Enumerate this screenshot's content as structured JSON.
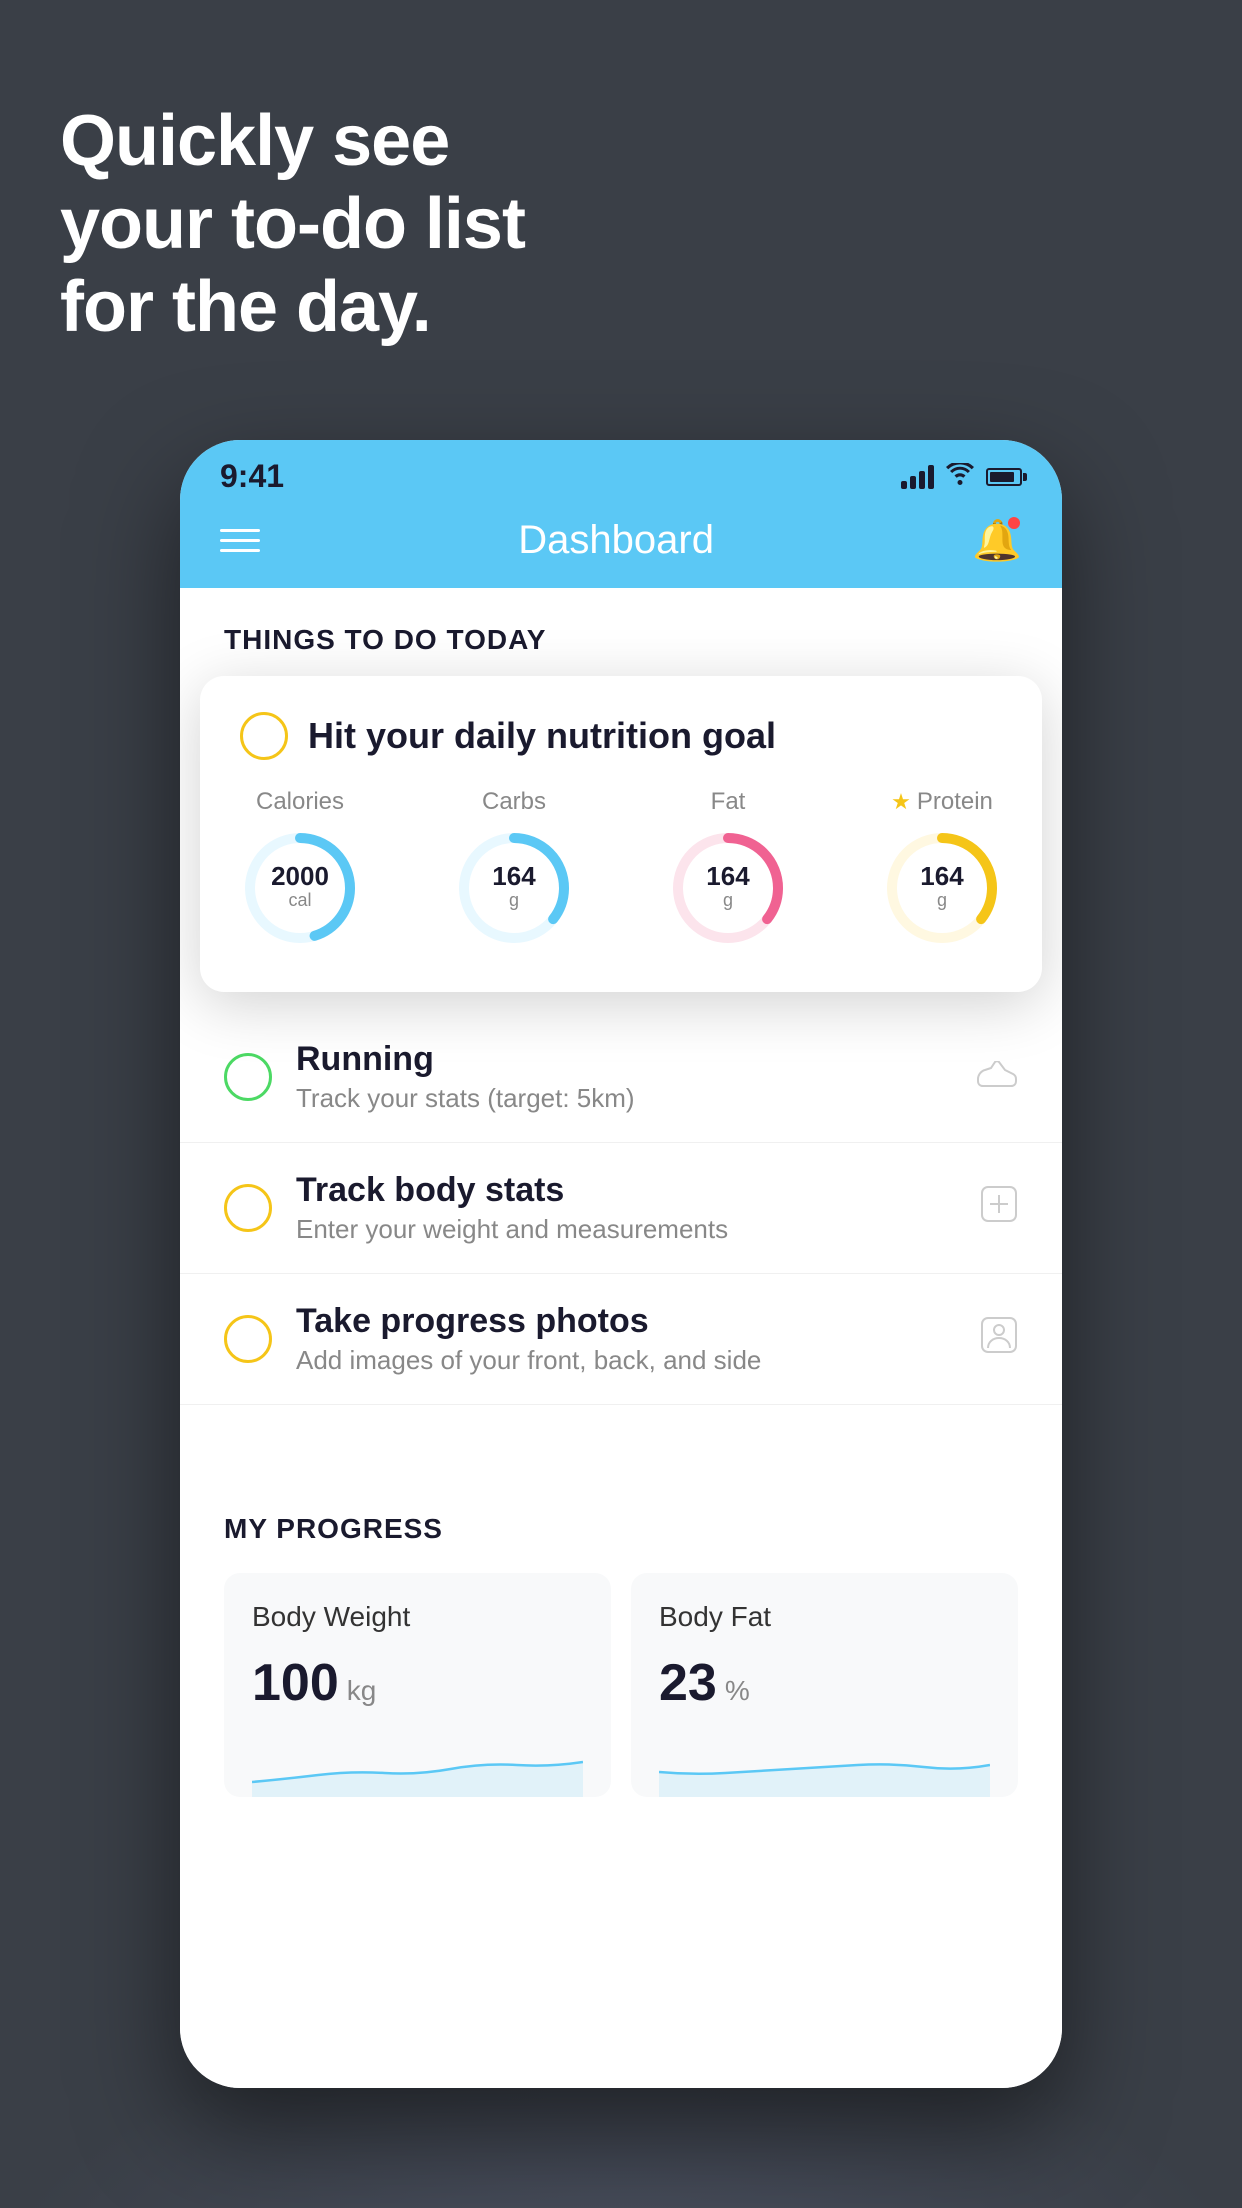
{
  "hero": {
    "line1": "Quickly see",
    "line2": "your to-do list",
    "line3": "for the day."
  },
  "phone": {
    "statusBar": {
      "time": "9:41"
    },
    "navBar": {
      "title": "Dashboard"
    },
    "thingsSection": {
      "sectionTitle": "THINGS TO DO TODAY"
    },
    "floatingCard": {
      "title": "Hit your daily nutrition goal",
      "nutrition": [
        {
          "label": "Calories",
          "value": "2000",
          "unit": "cal",
          "color": "#5bc8f5",
          "trackColor": "#e8f8ff",
          "hasStarLabel": false
        },
        {
          "label": "Carbs",
          "value": "164",
          "unit": "g",
          "color": "#5bc8f5",
          "trackColor": "#e8f8ff",
          "hasStarLabel": false
        },
        {
          "label": "Fat",
          "value": "164",
          "unit": "g",
          "color": "#f06292",
          "trackColor": "#fce4ec",
          "hasStarLabel": false
        },
        {
          "label": "Protein",
          "value": "164",
          "unit": "g",
          "color": "#f5c518",
          "trackColor": "#fff8e1",
          "hasStarLabel": true
        }
      ]
    },
    "listItems": [
      {
        "title": "Running",
        "subtitle": "Track your stats (target: 5km)",
        "circleColor": "green",
        "icon": "shoe"
      },
      {
        "title": "Track body stats",
        "subtitle": "Enter your weight and measurements",
        "circleColor": "yellow",
        "icon": "scale"
      },
      {
        "title": "Take progress photos",
        "subtitle": "Add images of your front, back, and side",
        "circleColor": "yellow",
        "icon": "person"
      }
    ],
    "progressSection": {
      "title": "MY PROGRESS",
      "cards": [
        {
          "title": "Body Weight",
          "value": "100",
          "unit": "kg"
        },
        {
          "title": "Body Fat",
          "value": "23",
          "unit": "%"
        }
      ]
    }
  }
}
